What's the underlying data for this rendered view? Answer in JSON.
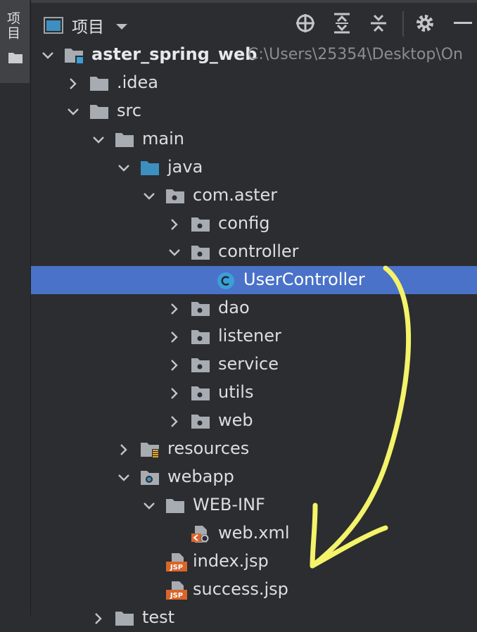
{
  "side_strip": {
    "tab_label": "项目"
  },
  "toolbar": {
    "title": "项目",
    "buttons": [
      "locate-icon",
      "expand-all-icon",
      "collapse-all-icon",
      "gear-icon",
      "minimize-icon"
    ]
  },
  "tree": [
    {
      "label": "aster_spring_web",
      "path": "C:\\Users\\25354\\Desktop\\On",
      "depth": 0,
      "expand": "open",
      "icon": "module-icon",
      "bold": true
    },
    {
      "label": ".idea",
      "depth": 1,
      "expand": "closed",
      "icon": "folder-icon"
    },
    {
      "label": "src",
      "depth": 1,
      "expand": "open",
      "icon": "folder-icon"
    },
    {
      "label": "main",
      "depth": 2,
      "expand": "open",
      "icon": "folder-icon"
    },
    {
      "label": "java",
      "depth": 3,
      "expand": "open",
      "icon": "source-folder-icon"
    },
    {
      "label": "com.aster",
      "depth": 4,
      "expand": "open",
      "icon": "package-icon"
    },
    {
      "label": "config",
      "depth": 5,
      "expand": "closed",
      "icon": "package-icon"
    },
    {
      "label": "controller",
      "depth": 5,
      "expand": "open",
      "icon": "package-icon"
    },
    {
      "label": "UserController",
      "depth": 6,
      "expand": "none",
      "icon": "class-icon",
      "selected": true
    },
    {
      "label": "dao",
      "depth": 5,
      "expand": "closed",
      "icon": "package-icon"
    },
    {
      "label": "listener",
      "depth": 5,
      "expand": "closed",
      "icon": "package-icon"
    },
    {
      "label": "service",
      "depth": 5,
      "expand": "closed",
      "icon": "package-icon"
    },
    {
      "label": "utils",
      "depth": 5,
      "expand": "closed",
      "icon": "package-icon"
    },
    {
      "label": "web",
      "depth": 5,
      "expand": "closed",
      "icon": "package-icon"
    },
    {
      "label": "resources",
      "depth": 3,
      "expand": "closed",
      "icon": "resources-folder-icon"
    },
    {
      "label": "webapp",
      "depth": 3,
      "expand": "open",
      "icon": "web-folder-icon"
    },
    {
      "label": "WEB-INF",
      "depth": 4,
      "expand": "open",
      "icon": "folder-icon"
    },
    {
      "label": "web.xml",
      "depth": 5,
      "expand": "none",
      "icon": "xml-file-icon"
    },
    {
      "label": "index.jsp",
      "depth": 4,
      "expand": "none",
      "icon": "jsp-file-icon"
    },
    {
      "label": "success.jsp",
      "depth": 4,
      "expand": "none",
      "icon": "jsp-file-icon"
    },
    {
      "label": "test",
      "depth": 2,
      "expand": "closed",
      "icon": "folder-icon"
    }
  ],
  "colors": {
    "background": "#2b2d30",
    "selection": "#4a72c8",
    "folder": "#a7abb2",
    "source_folder": "#3d8fbf",
    "class_icon": "#3b9fd8",
    "jsp_badge": "#d9652a",
    "annotation_arrow": "#f4f36a"
  }
}
